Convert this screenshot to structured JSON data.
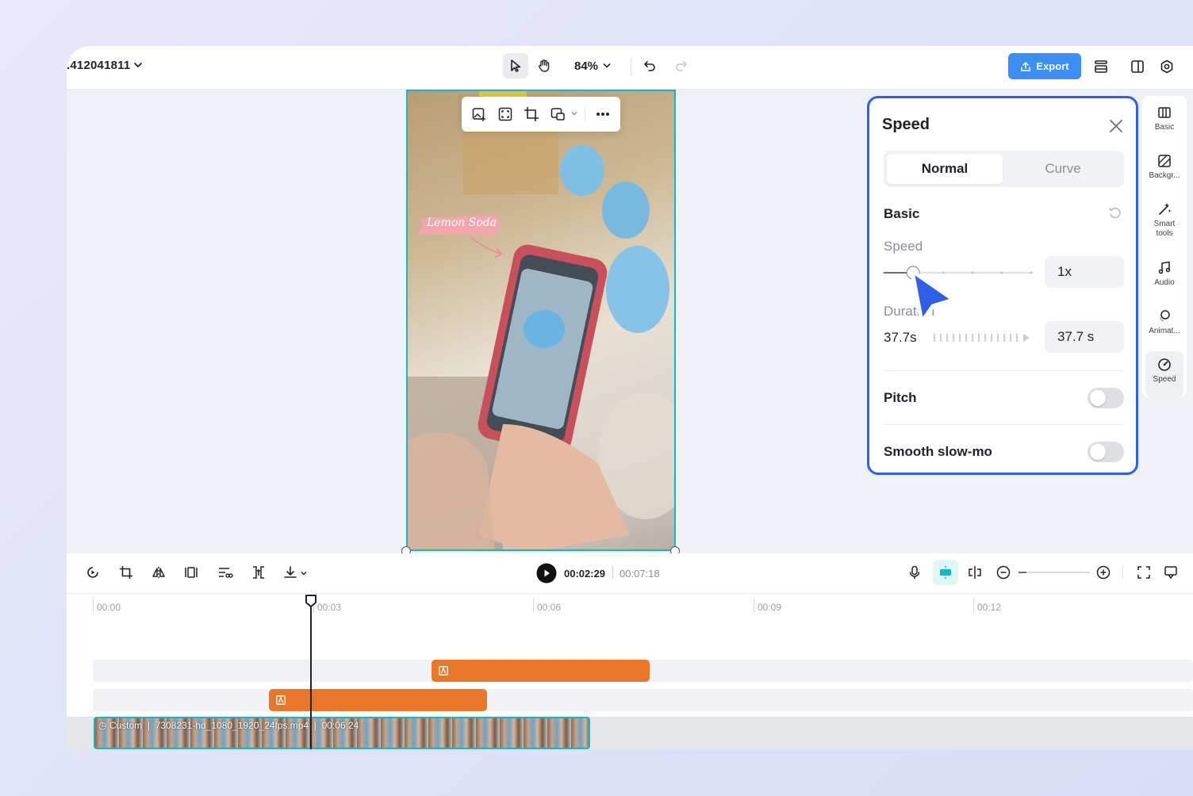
{
  "header": {
    "project_name": ".412041811",
    "zoom": "84%",
    "export_label": "Export"
  },
  "speed_panel": {
    "title": "Speed",
    "tabs": [
      {
        "label": "Normal",
        "selected": true
      },
      {
        "label": "Curve",
        "selected": false
      }
    ],
    "section_basic": "Basic",
    "speed_label": "Speed",
    "speed_value": "1x",
    "speed_slider_level": 0.2,
    "duration_label": "Duration",
    "duration_value": "37.7s",
    "duration_box": "37.7 s",
    "pitch_label": "Pitch",
    "pitch_on": false,
    "smooth_label": "Smooth slow-mo",
    "smooth_on": false
  },
  "rail": {
    "items": [
      {
        "label": "Basic",
        "icon": "basic-icon"
      },
      {
        "label": "Backgr...",
        "icon": "background-icon"
      },
      {
        "label": "Smart tools",
        "icon": "smart-tools-icon"
      },
      {
        "label": "Audio",
        "icon": "audio-icon"
      },
      {
        "label": "Animat...",
        "icon": "animation-icon"
      },
      {
        "label": "Speed",
        "icon": "speed-icon",
        "active": true
      }
    ]
  },
  "canvas": {
    "sticker_text": "Lemon Soda"
  },
  "timeline": {
    "current_time": "00:02:29",
    "total_time": "00:07:18",
    "ruler": [
      "00:00",
      "00:03",
      "00:06",
      "00:09",
      "00:12"
    ],
    "video_clip": {
      "speed_tag": "Custom",
      "filename": "7308231-hd_1080_1920_24fps.mp4",
      "duration": "00:06:24"
    }
  },
  "colors": {
    "accent_blue": "#3a8ef6",
    "panel_border": "#2f5fe8",
    "selection_teal": "#17b6c6",
    "clip_orange": "#e8772a"
  }
}
